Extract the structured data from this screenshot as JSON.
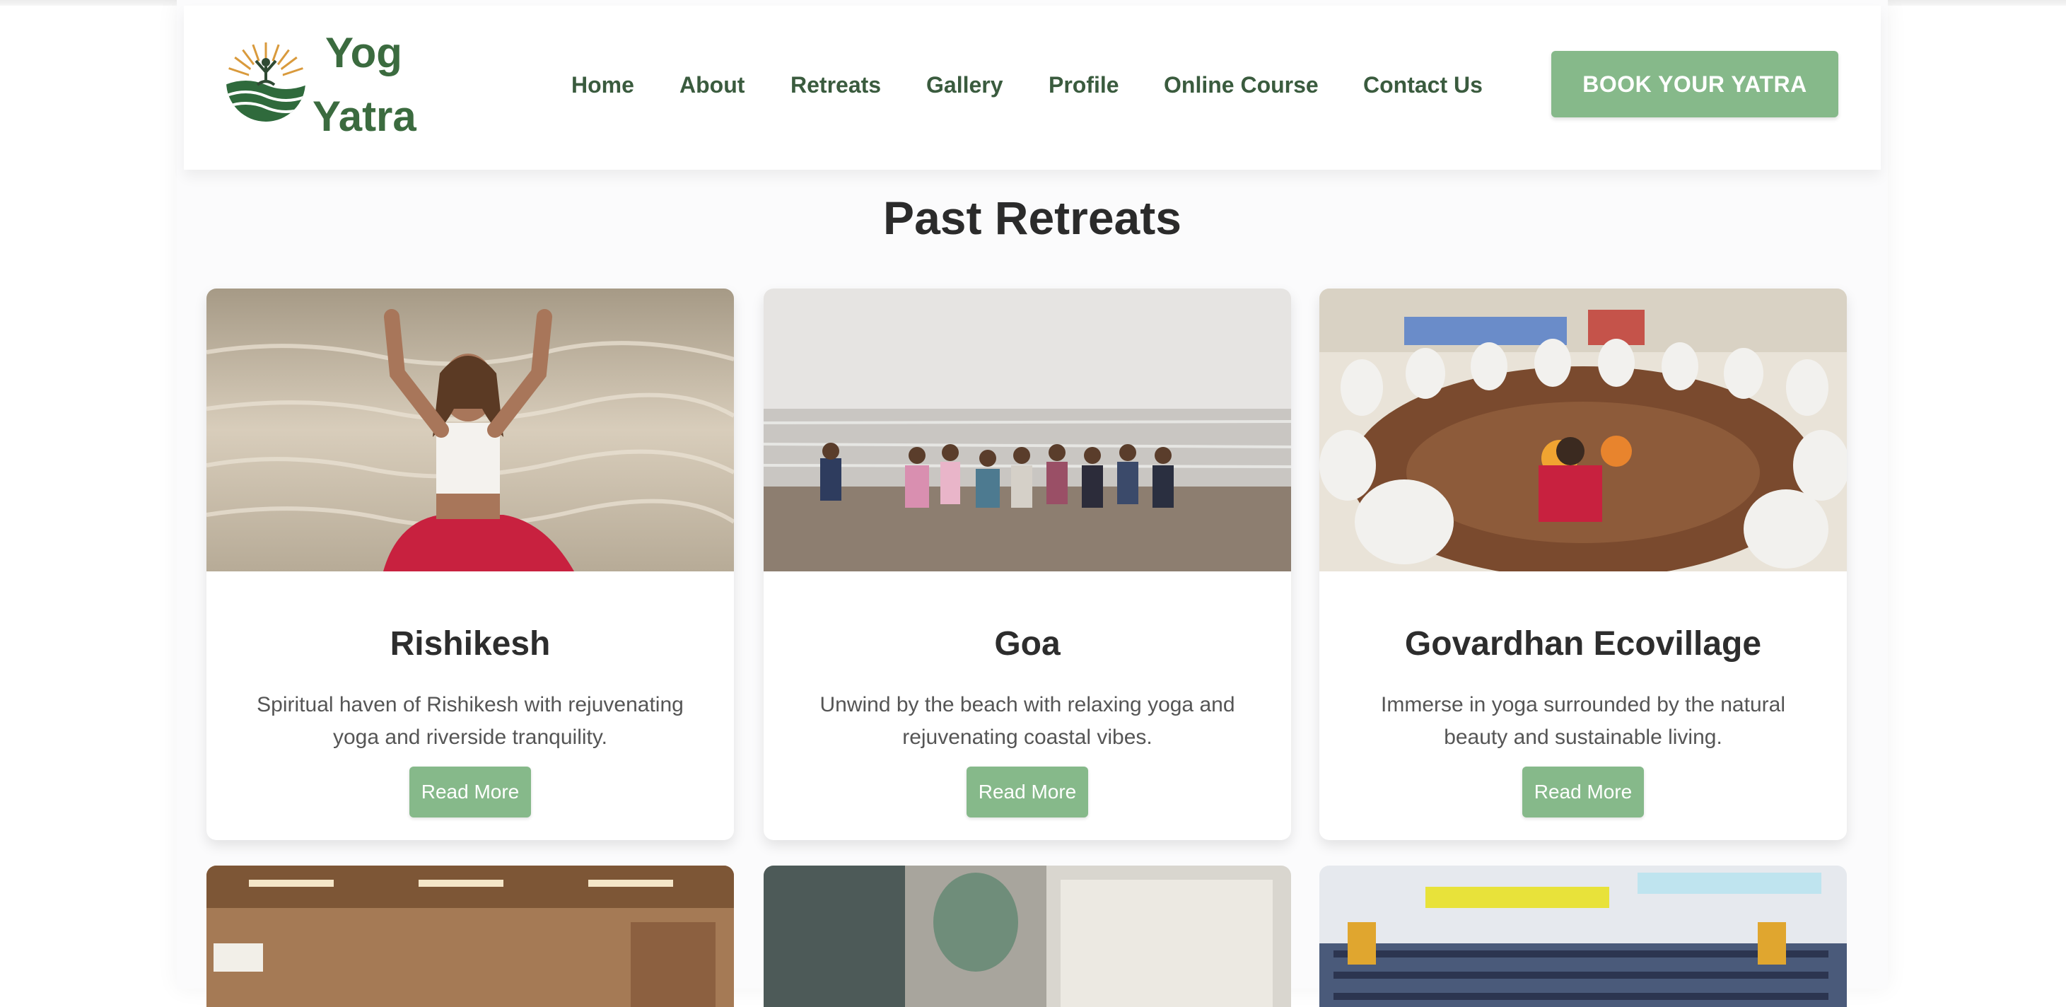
{
  "header": {
    "logo_line1": "Yog",
    "logo_line2": "Yatra",
    "nav": [
      {
        "label": "Home"
      },
      {
        "label": "About"
      },
      {
        "label": "Retreats"
      },
      {
        "label": "Gallery"
      },
      {
        "label": "Profile"
      },
      {
        "label": "Online Course"
      },
      {
        "label": "Contact Us"
      }
    ],
    "cta_label": "BOOK YOUR YATRA"
  },
  "main": {
    "section_title": "Past Retreats",
    "cards": [
      {
        "title": "Rishikesh",
        "description": "Spiritual haven of Rishikesh with rejuvenating yoga and riverside tranquility.",
        "button_label": "Read More",
        "image": "woman-meditating-by-river"
      },
      {
        "title": "Goa",
        "description": "Unwind by the beach with relaxing yoga and rejuvenating coastal vibes.",
        "button_label": "Read More",
        "image": "group-yoga-on-beach"
      },
      {
        "title": "Govardhan Ecovillage",
        "description": "Immerse in yoga surrounded by the natural beauty and sustainable living.",
        "button_label": "Read More",
        "image": "meditation-circle-indoors"
      }
    ],
    "partial_cards": [
      {
        "image": "indoor-hall-session"
      },
      {
        "image": "studio-group-session"
      },
      {
        "image": "large-auditorium-crowd"
      }
    ]
  },
  "colors": {
    "brand_green": "#3b6b3f",
    "button_green": "#86b98a",
    "heading": "#2b2b2b"
  }
}
